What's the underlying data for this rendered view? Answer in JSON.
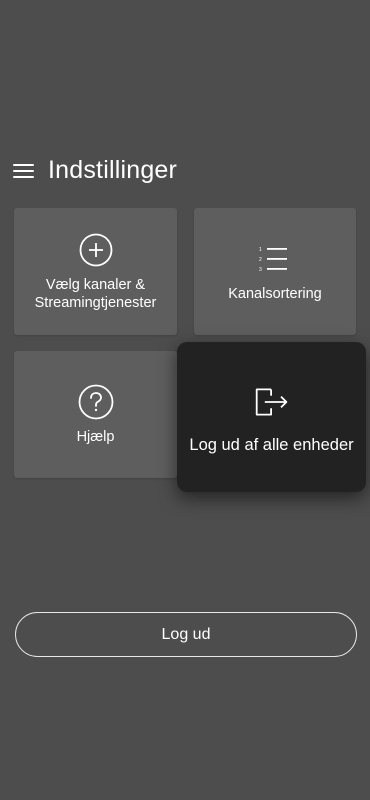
{
  "header": {
    "title": "Indstillinger",
    "menu_icon": "hamburger-menu-icon"
  },
  "tiles": {
    "channels": {
      "line1": "Vælg kanaler &",
      "line2": "Streamingtjenester",
      "icon": "plus-circle-icon"
    },
    "sorting": {
      "label": "Kanalsortering",
      "icon": "numbered-list-icon"
    },
    "help": {
      "label": "Hjælp",
      "icon": "question-circle-icon"
    },
    "logout_all": {
      "label": "Log ud af alle enheder",
      "icon": "logout-icon"
    }
  },
  "logout_button": {
    "label": "Log ud"
  },
  "colors": {
    "background": "#4d4d4d",
    "tile": "#5e5e5e",
    "highlight_tile": "#222222",
    "text": "#ffffff"
  }
}
